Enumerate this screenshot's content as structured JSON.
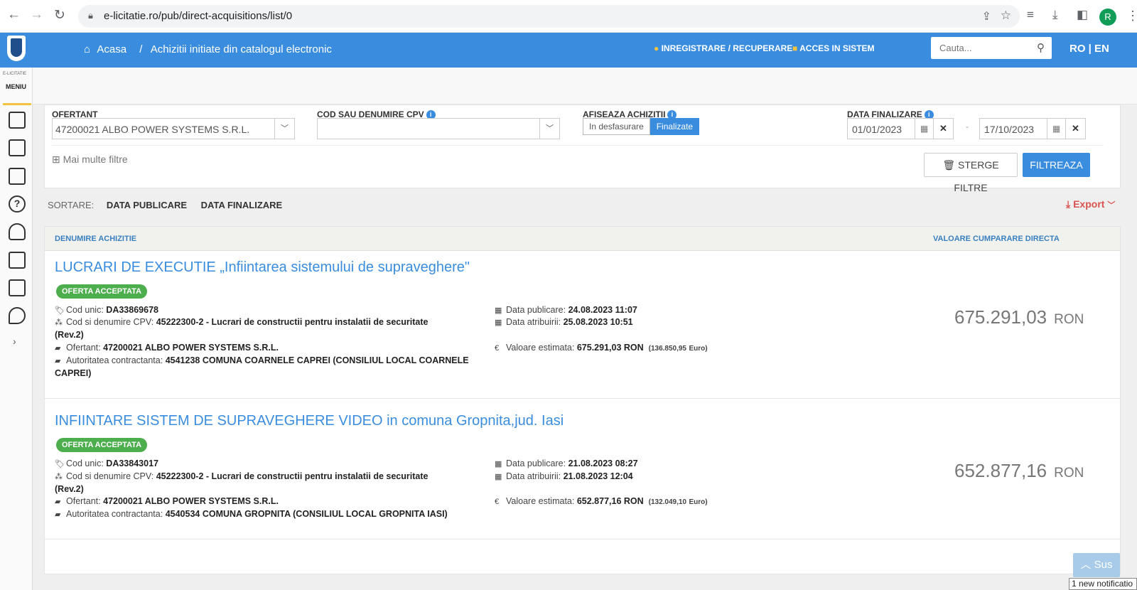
{
  "browser": {
    "url": "e-licitatie.ro/pub/direct-acquisitions/list/0",
    "profile_initial": "R"
  },
  "header": {
    "breadcrumb_home": "Acasa",
    "breadcrumb_sep": "/",
    "breadcrumb_current": "Achizitii initiate din catalogul electronic",
    "register_link": "INREGISTRARE / RECUPERARE",
    "login_link": "ACCES IN SISTEM",
    "search_placeholder": "Cauta...",
    "lang": "RO | EN",
    "color": "#3a8dde"
  },
  "sidebar": {
    "brand": "E-LICITATIE",
    "menu_label": "MENIU",
    "icons": [
      "document-icon",
      "list-export-icon",
      "shield-doc-icon",
      "help-icon",
      "person-icon",
      "id-card-icon",
      "catalog-icon",
      "chat-icon"
    ],
    "expand": "›"
  },
  "filters": {
    "ofertant_label": "OFERTANT",
    "ofertant_value": "47200021 ALBO POWER SYSTEMS S.R.L.",
    "cpv_label": "COD SAU DENUMIRE CPV",
    "cpv_value": "",
    "afiseaza_label": "AFISEAZA ACHIZITII",
    "toggle_off": "In desfasurare",
    "toggle_on": "Finalizate",
    "data_label": "DATA FINALIZARE",
    "date_from": "01/01/2023",
    "date_to": "17/10/2023",
    "more_filters": "Mai multe filtre",
    "clear_button": "STERGE FILTRE",
    "filter_button": "FILTREAZA"
  },
  "sort": {
    "label": "SORTARE:",
    "opt1": "DATA PUBLICARE",
    "opt2": "DATA FINALIZARE",
    "export": "Export"
  },
  "results": {
    "col_name": "DENUMIRE ACHIZITIE",
    "col_value": "VALOARE CUMPARARE DIRECTA",
    "items": [
      {
        "title": "LUCRARI DE EXECUTIE „Infiintarea sistemului de supraveghere\"",
        "status": "OFERTA ACCEPTATA",
        "cod_label": "Cod unic:",
        "cod": "DA33869678",
        "cpv_label": "Cod si denumire CPV:",
        "cpv": "45222300-2 - Lucrari de constructii pentru instalatii de securitate",
        "cpv_rev": "(Rev.2)",
        "ofertant_label": "Ofertant:",
        "ofertant": "47200021 ALBO POWER SYSTEMS S.R.L.",
        "autoritate_label": "Autoritatea contractanta:",
        "autoritate": "4541238 COMUNA COARNELE CAPREI (CONSILIUL LOCAL COARNELE",
        "autoritate_cont": "CAPREI)",
        "pub_label": "Data publicare:",
        "pub": "24.08.2023 11:07",
        "atr_label": "Data atribuirii:",
        "atr": "25.08.2023 10:51",
        "est_label": "Valoare estimata:",
        "est": "675.291,03  RON",
        "est_eur": "(136.850,95",
        "eur_unit": "Euro)",
        "value": "675.291,03",
        "currency": "RON"
      },
      {
        "title": "INFIINTARE SISTEM DE SUPRAVEGHERE VIDEO in comuna Gropnita,jud. Iasi",
        "status": "OFERTA ACCEPTATA",
        "cod_label": "Cod unic:",
        "cod": "DA33843017",
        "cpv_label": "Cod si denumire CPV:",
        "cpv": "45222300-2 - Lucrari de constructii pentru instalatii de securitate",
        "cpv_rev": "(Rev.2)",
        "ofertant_label": "Ofertant:",
        "ofertant": "47200021 ALBO POWER SYSTEMS S.R.L.",
        "autoritate_label": "Autoritatea contractanta:",
        "autoritate": "4540534 COMUNA GROPNITA (CONSILIUL LOCAL GROPNITA IASI)",
        "autoritate_cont": "",
        "pub_label": "Data publicare:",
        "pub": "21.08.2023 08:27",
        "atr_label": "Data atribuirii:",
        "atr": "21.08.2023 12:04",
        "est_label": "Valoare estimata:",
        "est": "652.877,16  RON",
        "est_eur": "(132.049,10",
        "eur_unit": "Euro)",
        "value": "652.877,16",
        "currency": "RON"
      }
    ]
  },
  "footer": {
    "sus": "Sus",
    "notification": "1 new notificatio"
  }
}
